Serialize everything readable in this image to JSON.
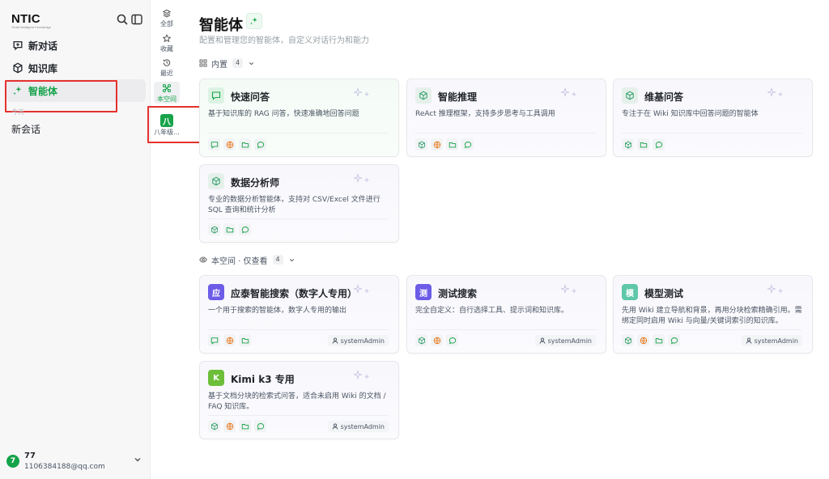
{
  "brand": {
    "logo": "NTIC",
    "tagline": "Yintai Intelligent Knowledge"
  },
  "sidebar": {
    "items": [
      {
        "label": "新对话"
      },
      {
        "label": "知识库"
      },
      {
        "label": "智能体"
      }
    ],
    "section_label": "今天",
    "conversation": "新会话"
  },
  "user": {
    "avatar": "7",
    "name": "77",
    "email": "1106384188@qq.com"
  },
  "rail": {
    "items": [
      {
        "label": "全部"
      },
      {
        "label": "收藏"
      },
      {
        "label": "最近"
      },
      {
        "label": "本空间"
      }
    ],
    "space": {
      "badge": "八",
      "label": "八年级..."
    }
  },
  "main": {
    "title": "智能体",
    "subtitle": "配置和管理您的智能体，自定义对话行为和能力",
    "groups": [
      {
        "label": "内置",
        "count": "4"
      },
      {
        "label": "本空间 · 仅查看",
        "count": "4"
      }
    ],
    "cards": [
      {
        "title": "快速问答",
        "desc": "基于知识库的 RAG 问答，快速准确地回答问题"
      },
      {
        "title": "智能推理",
        "desc": "ReAct 推理框架，支持多步思考与工具调用"
      },
      {
        "title": "维基问答",
        "desc": "专注于在 Wiki 知识库中回答问题的智能体"
      },
      {
        "title": "数据分析师",
        "desc": "专业的数据分析智能体，支持对 CSV/Excel 文件进行 SQL 查询和统计分析"
      },
      {
        "title": "应泰智能搜索（数字人专用）",
        "desc": "一个用于搜索的智能体，数字人专用的输出",
        "badge": "应",
        "owner": "systemAdmin"
      },
      {
        "title": "测试搜索",
        "desc": "完全自定义：自行选择工具、提示词和知识库。",
        "badge": "测",
        "owner": "systemAdmin"
      },
      {
        "title": "模型测试",
        "desc": "先用 Wiki 建立导航和背景，再用分块检索精确引用。需绑定同时启用 Wiki 与向量/关键词索引的知识库。",
        "badge": "模",
        "owner": "systemAdmin"
      },
      {
        "title": "Kimi k3 专用",
        "desc": "基于文档分块的检索式问答，适合未启用 Wiki 的文档 / FAQ 知识库。",
        "badge": "K",
        "owner": "systemAdmin"
      }
    ]
  },
  "colors": {
    "accent": "#16a34a",
    "highlight_box": "#e5322d",
    "badge_purple": "#6c5ce7",
    "badge_mint": "#5fc8a8",
    "badge_green": "#6dbf3a",
    "badge_blue": "#4f7fd6"
  }
}
